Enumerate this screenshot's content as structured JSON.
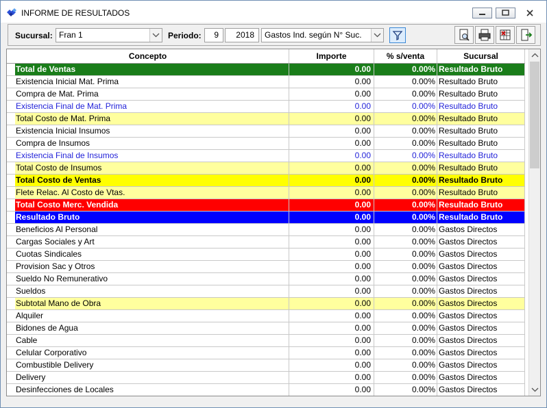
{
  "window": {
    "title": "INFORME DE RESULTADOS"
  },
  "toolbar": {
    "sucursal_label": "Sucursal:",
    "sucursal_value": "Fran 1",
    "periodo_label": "Periodo:",
    "mes": "9",
    "anio": "2018",
    "tipo_value": "Gastos Ind. según N° Suc."
  },
  "columns": {
    "concepto": "Concepto",
    "importe": "Importe",
    "pct": "% s/venta",
    "sucursal": "Sucursal"
  },
  "colors": {
    "green": "#1a7d1a",
    "yellow": "#ffff9e",
    "yellow_bold": "#ffff00",
    "red": "#ff0000",
    "blue": "#0000ff",
    "link_text": "#1f1fd8"
  },
  "rows": [
    {
      "concepto": "Total de Ventas",
      "importe": "0.00",
      "pct": "0.00%",
      "sucursal": "Resultado Bruto",
      "style": "green"
    },
    {
      "concepto": "Existencia Inicial Mat. Prima",
      "importe": "0.00",
      "pct": "0.00%",
      "sucursal": "Resultado Bruto",
      "style": "normal"
    },
    {
      "concepto": "Compra de Mat. Prima",
      "importe": "0.00",
      "pct": "0.00%",
      "sucursal": "Resultado Bruto",
      "style": "normal"
    },
    {
      "concepto": "Existencia Final de Mat. Prima",
      "importe": "0.00",
      "pct": "0.00%",
      "sucursal": "Resultado Bruto",
      "style": "bluetext"
    },
    {
      "concepto": "Total Costo de Mat. Prima",
      "importe": "0.00",
      "pct": "0.00%",
      "sucursal": "Resultado Bruto",
      "style": "yellow"
    },
    {
      "concepto": "Existencia Inicial Insumos",
      "importe": "0.00",
      "pct": "0.00%",
      "sucursal": "Resultado Bruto",
      "style": "normal"
    },
    {
      "concepto": "Compra de Insumos",
      "importe": "0.00",
      "pct": "0.00%",
      "sucursal": "Resultado Bruto",
      "style": "normal"
    },
    {
      "concepto": "Existencia Final de Insumos",
      "importe": "0.00",
      "pct": "0.00%",
      "sucursal": "Resultado Bruto",
      "style": "bluetext"
    },
    {
      "concepto": "Total Costo de Insumos",
      "importe": "0.00",
      "pct": "0.00%",
      "sucursal": "Resultado Bruto",
      "style": "yellow"
    },
    {
      "concepto": "Total Costo de Ventas",
      "importe": "0.00",
      "pct": "0.00%",
      "sucursal": "Resultado Bruto",
      "style": "yellowbold"
    },
    {
      "concepto": "Flete Relac. Al Costo de Vtas.",
      "importe": "0.00",
      "pct": "0.00%",
      "sucursal": "Resultado Bruto",
      "style": "yellow"
    },
    {
      "concepto": "Total Costo Merc. Vendida",
      "importe": "0.00",
      "pct": "0.00%",
      "sucursal": "Resultado Bruto",
      "style": "red"
    },
    {
      "concepto": "Resultado Bruto",
      "importe": "0.00",
      "pct": "0.00%",
      "sucursal": "Resultado Bruto",
      "style": "blue"
    },
    {
      "concepto": "Beneficios Al Personal",
      "importe": "0.00",
      "pct": "0.00%",
      "sucursal": "Gastos Directos",
      "style": "normal"
    },
    {
      "concepto": "Cargas Sociales y Art",
      "importe": "0.00",
      "pct": "0.00%",
      "sucursal": "Gastos Directos",
      "style": "normal"
    },
    {
      "concepto": "Cuotas Sindicales",
      "importe": "0.00",
      "pct": "0.00%",
      "sucursal": "Gastos Directos",
      "style": "normal"
    },
    {
      "concepto": "Provision Sac y Otros",
      "importe": "0.00",
      "pct": "0.00%",
      "sucursal": "Gastos Directos",
      "style": "normal"
    },
    {
      "concepto": "Sueldo No Remunerativo",
      "importe": "0.00",
      "pct": "0.00%",
      "sucursal": "Gastos Directos",
      "style": "normal"
    },
    {
      "concepto": "Sueldos",
      "importe": "0.00",
      "pct": "0.00%",
      "sucursal": "Gastos Directos",
      "style": "normal"
    },
    {
      "concepto": "Subtotal Mano de Obra",
      "importe": "0.00",
      "pct": "0.00%",
      "sucursal": "Gastos Directos",
      "style": "yellow"
    },
    {
      "concepto": "Alquiler",
      "importe": "0.00",
      "pct": "0.00%",
      "sucursal": "Gastos Directos",
      "style": "normal"
    },
    {
      "concepto": "Bidones de Agua",
      "importe": "0.00",
      "pct": "0.00%",
      "sucursal": "Gastos Directos",
      "style": "normal"
    },
    {
      "concepto": "Cable",
      "importe": "0.00",
      "pct": "0.00%",
      "sucursal": "Gastos Directos",
      "style": "normal"
    },
    {
      "concepto": "Celular Corporativo",
      "importe": "0.00",
      "pct": "0.00%",
      "sucursal": "Gastos Directos",
      "style": "normal"
    },
    {
      "concepto": "Combustible Delivery",
      "importe": "0.00",
      "pct": "0.00%",
      "sucursal": "Gastos Directos",
      "style": "normal"
    },
    {
      "concepto": "Delivery",
      "importe": "0.00",
      "pct": "0.00%",
      "sucursal": "Gastos Directos",
      "style": "normal"
    },
    {
      "concepto": "Desinfecciones de Locales",
      "importe": "0.00",
      "pct": "0.00%",
      "sucursal": "Gastos Directos",
      "style": "normal"
    }
  ]
}
